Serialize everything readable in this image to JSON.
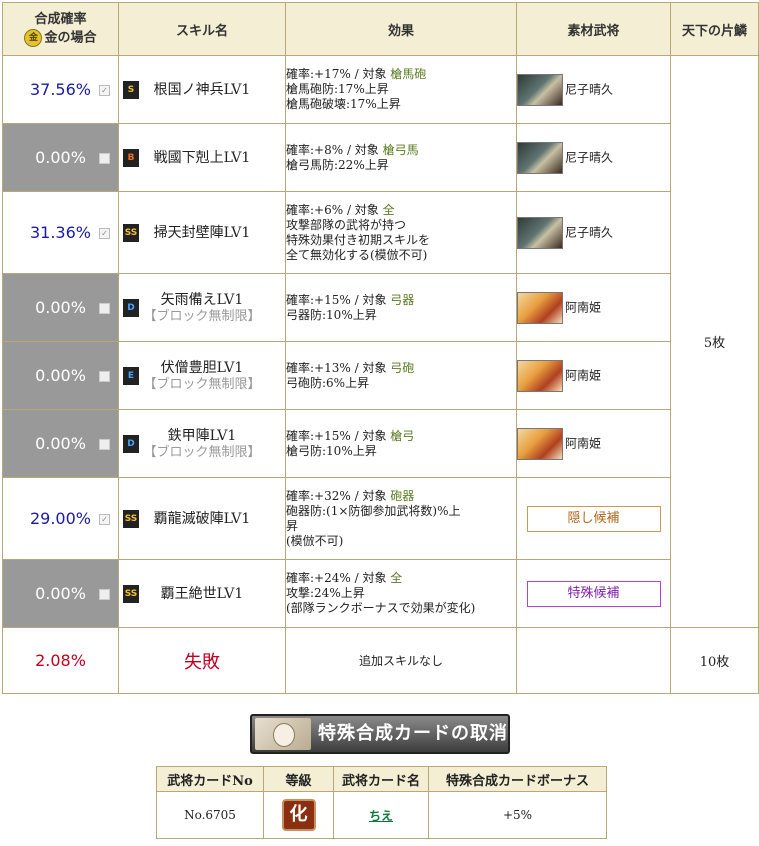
{
  "header": {
    "rate_line1": "合成確率",
    "rate_coin": "金",
    "rate_line2": "金の場合",
    "skill": "スキル名",
    "effect": "効果",
    "material": "素材武将",
    "pieces": "天下の片鱗"
  },
  "rows": [
    {
      "rate": "37.56%",
      "checked": true,
      "rank": "S",
      "skill": "根国ノ神兵LV1",
      "sub": "",
      "eff1": "確率:+17% / 対象 ",
      "target": "槍馬砲",
      "eff2": "槍馬砲防:17%上昇",
      "eff3": "槍馬砲破壊:17%上昇",
      "eff4": "",
      "material": "尼子晴久",
      "portrait": "a"
    },
    {
      "rate": "0.00%",
      "checked": false,
      "rank": "B",
      "skill": "戦國下剋上LV1",
      "sub": "",
      "eff1": "確率:+8% / 対象 ",
      "target": "槍弓馬",
      "eff2": "槍弓馬防:22%上昇",
      "eff3": "",
      "eff4": "",
      "material": "尼子晴久",
      "portrait": "a"
    },
    {
      "rate": "31.36%",
      "checked": true,
      "rank": "SS",
      "skill": "掃天封壁陣LV1",
      "sub": "",
      "eff1": "確率:+6% / 対象 ",
      "target": "全",
      "eff2": "攻撃部隊の武将が持つ",
      "eff3": "特殊効果付き初期スキルを",
      "eff4": "全て無効化する(模倣不可)",
      "material": "尼子晴久",
      "portrait": "a"
    },
    {
      "rate": "0.00%",
      "checked": false,
      "rank": "D",
      "skill": "矢雨備えLV1",
      "sub": "【ブロック無制限】",
      "eff1": "確率:+15% / 対象 ",
      "target": "弓器",
      "eff2": "弓器防:10%上昇",
      "eff3": "",
      "eff4": "",
      "material": "阿南姫",
      "portrait": "b"
    },
    {
      "rate": "0.00%",
      "checked": false,
      "rank": "E",
      "skill": "伏僧豊胆LV1",
      "sub": "【ブロック無制限】",
      "eff1": "確率:+13% / 対象 ",
      "target": "弓砲",
      "eff2": "弓砲防:6%上昇",
      "eff3": "",
      "eff4": "",
      "material": "阿南姫",
      "portrait": "b"
    },
    {
      "rate": "0.00%",
      "checked": false,
      "rank": "D",
      "skill": "鉄甲陣LV1",
      "sub": "【ブロック無制限】",
      "eff1": "確率:+15% / 対象 ",
      "target": "槍弓",
      "eff2": "槍弓防:10%上昇",
      "eff3": "",
      "eff4": "",
      "material": "阿南姫",
      "portrait": "b"
    },
    {
      "rate": "29.00%",
      "checked": true,
      "rank": "SS",
      "skill": "覇龍滅破陣LV1",
      "sub": "",
      "eff1": "確率:+32% / 対象 ",
      "target": "砲器",
      "eff2": "砲器防:(1×防御参加武将数)%上",
      "eff3": "昇",
      "eff4": "(模倣不可)",
      "material_button": "隠し候補",
      "btn": "hidden"
    },
    {
      "rate": "0.00%",
      "checked": false,
      "rank": "SS",
      "skill": "覇王絶世LV1",
      "sub": "",
      "eff1": "確率:+24% / 対象 ",
      "target": "全",
      "eff2": "攻撃:24%上昇",
      "eff3": "(部隊ランクボーナスで効果が変化)",
      "eff4": "",
      "material_button": "特殊候補",
      "btn": "special"
    }
  ],
  "pieces_main": "5枚",
  "fail": {
    "rate": "2.08%",
    "label": "失敗",
    "effect": "追加スキルなし",
    "pieces": "10枚"
  },
  "cancel_button": "特殊合成カードの取消",
  "card_table": {
    "headers": [
      "武将カードNo",
      "等級",
      "武将カード名",
      "特殊合成カードボーナス"
    ],
    "no": "No.6705",
    "grade": "化",
    "name": "ちえ",
    "bonus": "+5%"
  }
}
